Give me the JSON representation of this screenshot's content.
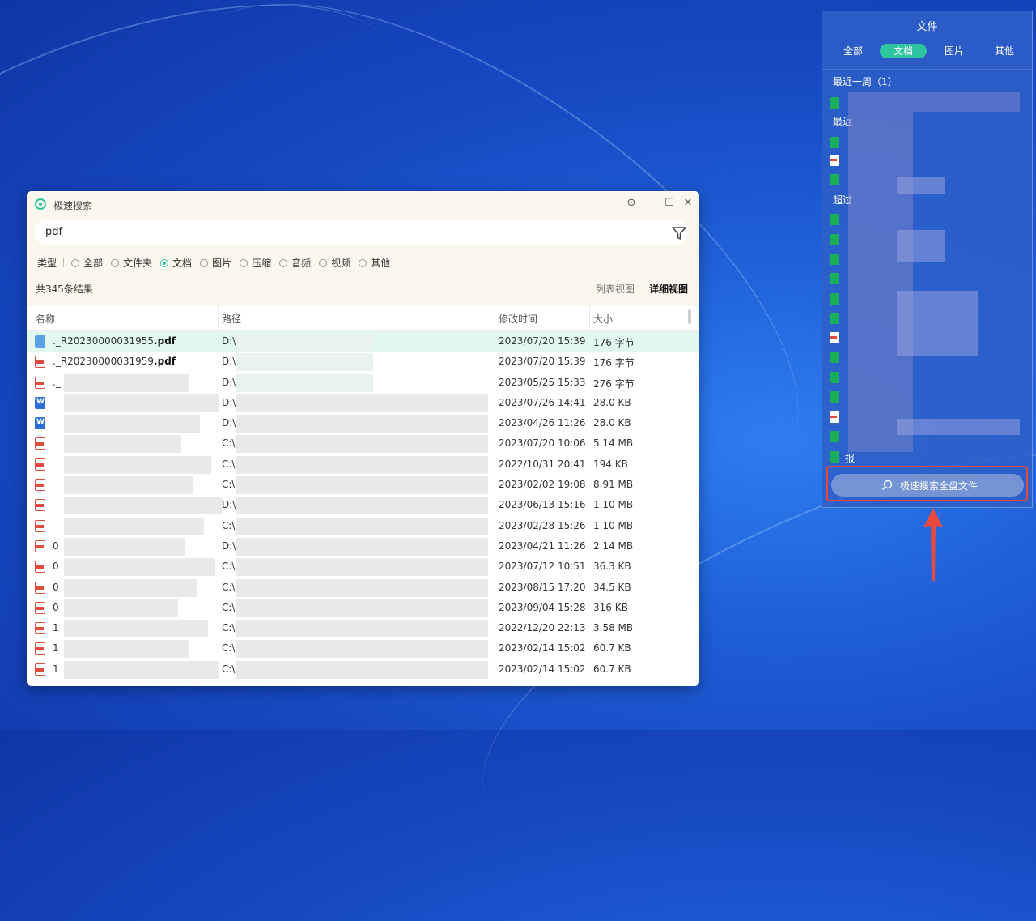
{
  "search_window": {
    "title": "极速搜索",
    "query": "pdf",
    "type_label": "类型",
    "type_options": [
      "全部",
      "文件夹",
      "文档",
      "图片",
      "压缩",
      "音频",
      "视频",
      "其他"
    ],
    "selected_type": "文档",
    "result_count": "共345条结果",
    "view_list": "列表视图",
    "view_detail": "详细视图",
    "columns": [
      "名称",
      "路径",
      "修改时间",
      "大小"
    ],
    "rows": [
      {
        "icon": "pdf-selected",
        "name_prefix": "._R20230000031955",
        "name_ext": ".pdf",
        "path": "D:\\",
        "time": "2023/07/20 15:39",
        "size": "176 字节"
      },
      {
        "icon": "pdf",
        "name_prefix": "._R20230000031959",
        "name_ext": ".pdf",
        "path": "D:\\",
        "time": "2023/07/20 15:39",
        "size": "176 字节"
      },
      {
        "icon": "pdf",
        "name_prefix": "._",
        "name_ext": "",
        "path": "D:\\",
        "time": "2023/05/25 15:33",
        "size": "276 字节"
      },
      {
        "icon": "word",
        "name_prefix": "",
        "name_ext": "",
        "path": "D:\\",
        "time": "2023/07/26 14:41",
        "size": "28.0 KB"
      },
      {
        "icon": "word",
        "name_prefix": "",
        "name_ext": "",
        "path": "D:\\",
        "time": "2023/04/26 11:26",
        "size": "28.0 KB"
      },
      {
        "icon": "pdf",
        "name_prefix": "",
        "name_ext": "",
        "path": "C:\\",
        "time": "2023/07/20 10:06",
        "size": "5.14 MB"
      },
      {
        "icon": "pdf",
        "name_prefix": "",
        "name_ext": "",
        "path": "C:\\",
        "time": "2022/10/31 20:41",
        "size": "194 KB"
      },
      {
        "icon": "pdf",
        "name_prefix": "",
        "name_ext": "",
        "path": "C:\\",
        "time": "2023/02/02 19:08",
        "size": "8.91 MB"
      },
      {
        "icon": "pdf",
        "name_prefix": "",
        "name_ext": "",
        "path": "D:\\",
        "time": "2023/06/13 15:16",
        "size": "1.10 MB"
      },
      {
        "icon": "pdf",
        "name_prefix": "",
        "name_ext": "",
        "path": "C:\\",
        "time": "2023/02/28 15:26",
        "size": "1.10 MB"
      },
      {
        "icon": "pdf",
        "name_prefix": "0",
        "name_ext": "",
        "path": "D:\\",
        "time": "2023/04/21 11:26",
        "size": "2.14 MB"
      },
      {
        "icon": "pdf",
        "name_prefix": "0",
        "name_ext": "",
        "path": "C:\\",
        "time": "2023/07/12 10:51",
        "size": "36.3 KB"
      },
      {
        "icon": "pdf",
        "name_prefix": "0",
        "name_ext": "",
        "path": "C:\\",
        "time": "2023/08/15 17:20",
        "size": "34.5 KB"
      },
      {
        "icon": "pdf",
        "name_prefix": "0",
        "name_ext": "",
        "path": "C:\\",
        "time": "2023/09/04 15:28",
        "size": "316 KB"
      },
      {
        "icon": "pdf",
        "name_prefix": "1",
        "name_ext": "",
        "path": "C:\\",
        "time": "2022/12/20 22:13",
        "size": "3.58 MB"
      },
      {
        "icon": "pdf",
        "name_prefix": "1",
        "name_ext": "",
        "path": "C:\\",
        "time": "2023/02/14 15:02",
        "size": "60.7 KB"
      },
      {
        "icon": "pdf",
        "name_prefix": "1",
        "name_ext": "",
        "path": "C:\\",
        "time": "2023/02/14 15:02",
        "size": "60.7 KB"
      }
    ]
  },
  "file_panel": {
    "title": "文件",
    "tabs": [
      "全部",
      "文档",
      "图片",
      "其他"
    ],
    "active_tab": "文档",
    "section_week": "最近一周（1）",
    "section_recent": "最近",
    "section_over": "超过",
    "last_item": "报",
    "search_all_button": "极速搜索全盘文件"
  },
  "colors": {
    "accent": "#2fc5a0",
    "highlight_red": "#e3463d",
    "selected_row": "#e2f7f0"
  }
}
